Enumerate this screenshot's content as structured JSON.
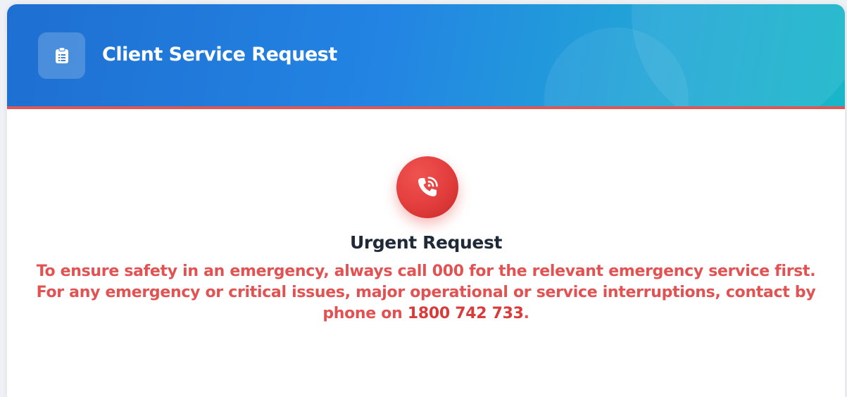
{
  "header": {
    "title": "Client Service Request",
    "icon": "clipboard-icon"
  },
  "colors": {
    "header_gradient_start": "#1e6fd1",
    "header_gradient_end": "#19b6c9",
    "accent_red": "#e25555",
    "title_dark": "#1f2937"
  },
  "urgent": {
    "icon": "phone-ringing-icon",
    "title": "Urgent Request",
    "line1": "To ensure safety in an emergency, always call 000 for the relevant emergency service first.",
    "line2_prefix": "For any emergency or critical issues, major operational or service interruptions, contact by phone on ",
    "phone": "1800 742 733",
    "line2_suffix": "."
  }
}
